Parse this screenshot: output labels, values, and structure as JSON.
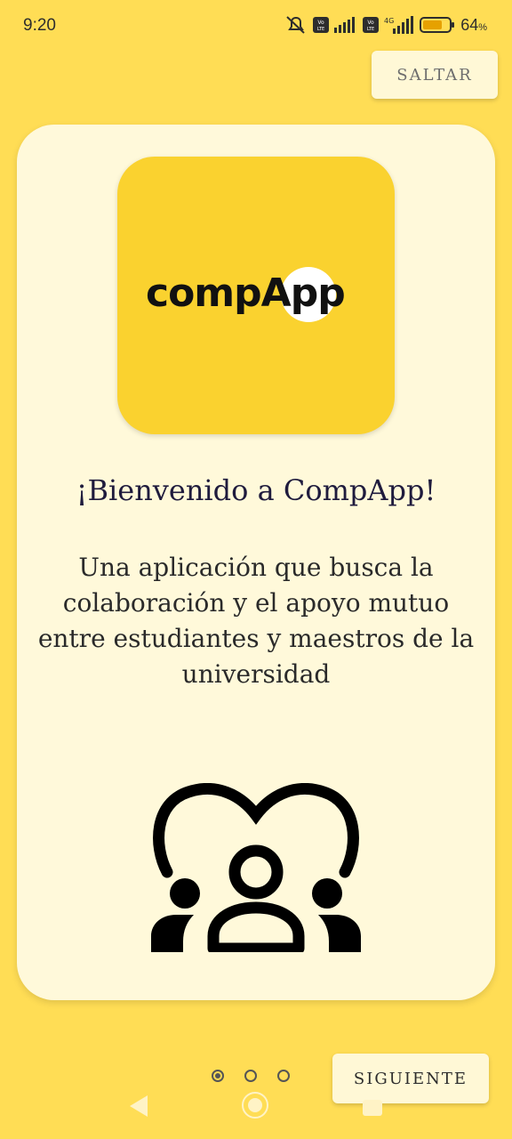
{
  "status_bar": {
    "time": "9:20",
    "battery": "64",
    "battery_unit": "%",
    "network": "4G",
    "volte": "Vo LTE",
    "icons": [
      "mute-icon",
      "volte-icon",
      "signal-icon",
      "wifi-icon",
      "battery-icon"
    ]
  },
  "skip_label": "SALTAR",
  "logo": {
    "text": "compApp"
  },
  "title": "¡Bienvenido a CompApp!",
  "description": "Una aplicación que busca la colaboración y el apoyo mutuo entre estudiantes y maestros de la universidad",
  "pager": {
    "total": 3,
    "current": 1
  },
  "next_label": "SIGUIENTE",
  "colors": {
    "background": "#FFDD55",
    "card": "#FFF9DA",
    "logo_bg": "#FAD22F",
    "title": "#1F1B3D"
  }
}
